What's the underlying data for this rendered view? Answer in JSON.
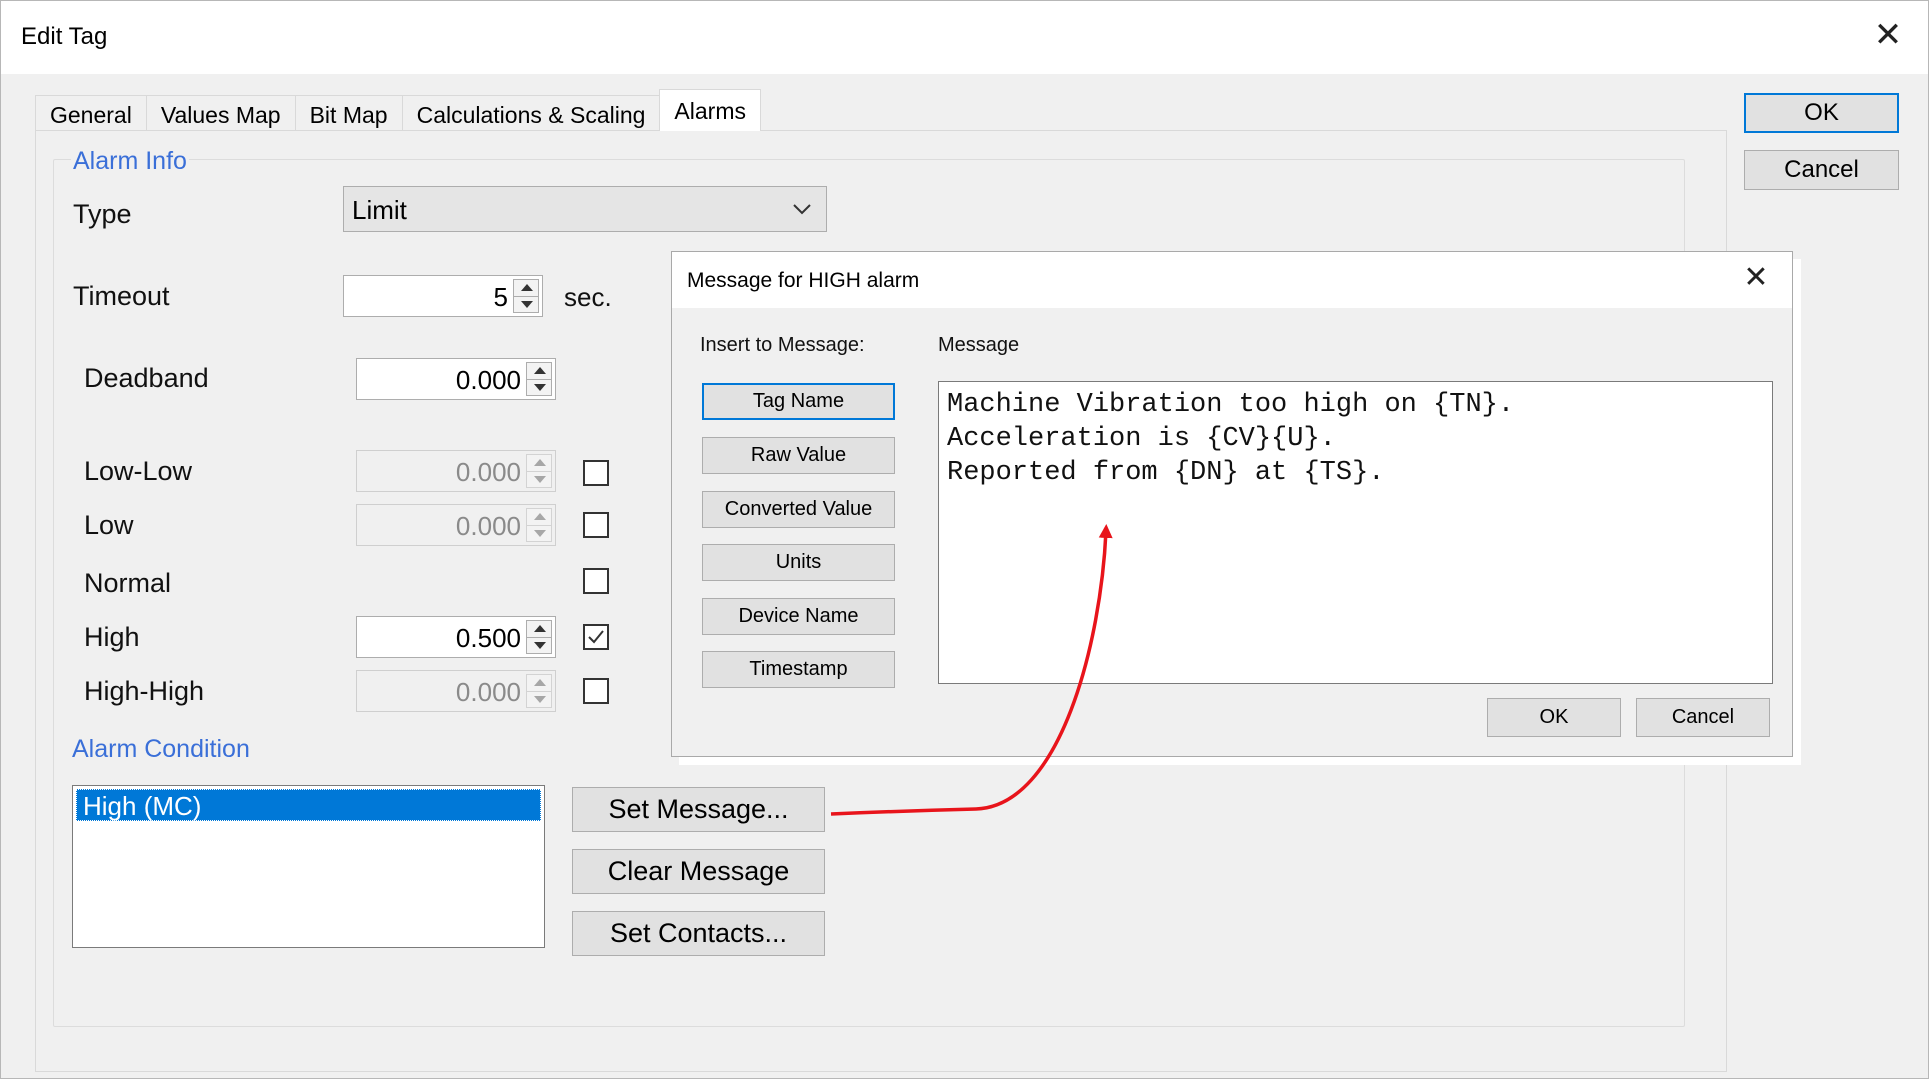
{
  "window": {
    "title": "Edit Tag",
    "close_icon": "close-icon"
  },
  "tabs": [
    {
      "label": "General"
    },
    {
      "label": "Values Map"
    },
    {
      "label": "Bit Map"
    },
    {
      "label": "Calculations & Scaling"
    },
    {
      "label": "Alarms",
      "active": true
    }
  ],
  "buttons": {
    "ok": "OK",
    "cancel": "Cancel"
  },
  "alarm_info": {
    "legend": "Alarm Info",
    "type_label": "Type",
    "type_value": "Limit",
    "timeout_label": "Timeout",
    "timeout_value": "5",
    "timeout_unit": "sec.",
    "deadband_label": "Deadband",
    "deadband_value": "0.000",
    "limits": [
      {
        "label": "Low-Low",
        "value": "0.000",
        "checked": false,
        "enabled": false
      },
      {
        "label": "Low",
        "value": "0.000",
        "checked": false,
        "enabled": false
      },
      {
        "label": "Normal",
        "checked": false
      },
      {
        "label": "High",
        "value": "0.500",
        "checked": true,
        "enabled": true
      },
      {
        "label": "High-High",
        "value": "0.000",
        "checked": false,
        "enabled": false
      }
    ]
  },
  "alarm_condition": {
    "label": "Alarm Condition",
    "items": [
      "High (MC)"
    ],
    "selected": "High (MC)",
    "set_message": "Set Message...",
    "clear_message": "Clear Message",
    "set_contacts": "Set Contacts..."
  },
  "message_dialog": {
    "title": "Message for HIGH alarm",
    "insert_label": "Insert to Message:",
    "message_label": "Message",
    "insert_buttons": [
      "Tag Name",
      "Raw Value",
      "Converted Value",
      "Units",
      "Device Name",
      "Timestamp"
    ],
    "message_lines": [
      "Machine Vibration too high on {TN}.",
      "Acceleration is {CV}{U}.",
      "Reported from {DN} at {TS}."
    ],
    "ok": "OK",
    "cancel": "Cancel"
  },
  "colors": {
    "accent": "#0078d7",
    "group_label": "#3a6fd8",
    "annotation_arrow": "#e8141b"
  }
}
